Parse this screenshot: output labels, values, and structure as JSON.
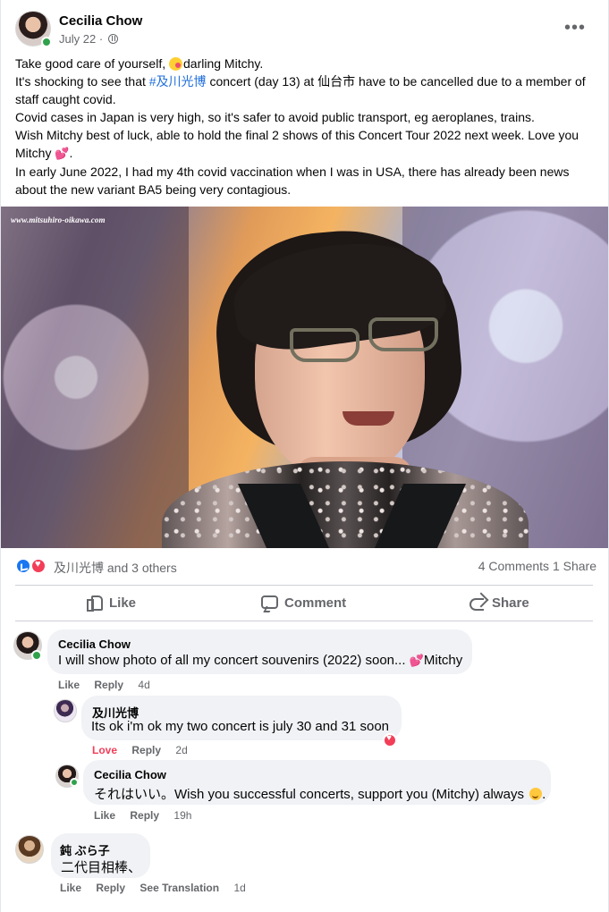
{
  "post": {
    "author": "Cecilia Chow",
    "date": "July 22",
    "date_separator": "·",
    "paragraphs": [
      {
        "before_emoji": "Take good care of yourself, ",
        "after_emoji": "darling Mitchy."
      },
      {
        "before_hashtag": "It's shocking to see that ",
        "hashtag": "#及川光博",
        "after_hashtag": " concert (day 13) at 仙台市 have to be cancelled due to a member of staff caught covid."
      },
      {
        "text": "Covid cases in Japan is very high, so it's safer to avoid public transport, eg aeroplanes, trains."
      },
      {
        "before_heart": "Wish Mitchy best of luck, able to hold the final 2 shows of this Concert Tour 2022 next week.  Love you Mitchy ",
        "heart": "💕",
        "after_heart": "."
      },
      {
        "text": "In early June 2022, I had my 4th covid vaccination when I was in USA, there has already been news about the new variant BA5 being very contagious."
      }
    ],
    "watermark": "www.mitsuhiro-oikawa.com",
    "reactions": {
      "names": "及川光博 and 3 others",
      "comments": "4 Comments",
      "shares": "1 Share"
    },
    "actions": {
      "like": "Like",
      "comment": "Comment",
      "share": "Share"
    }
  },
  "comments": [
    {
      "author": "Cecilia Chow",
      "text_before_heart": "I will show photo of all my concert souvenirs (2022) soon... ",
      "heart": "💕",
      "text_after_heart": "Mitchy",
      "actions": {
        "like": "Like",
        "reply": "Reply",
        "time": "4d"
      }
    },
    {
      "author": "及川光博",
      "text": "Its ok i'm ok my two concert is july 30 and 31 soon",
      "actions": {
        "reaction": "Love",
        "reply": "Reply",
        "time": "2d"
      }
    },
    {
      "author": "Cecilia Chow",
      "text": "それはいい。Wish you successful concerts, support you (Mitchy) always ",
      "end": ".",
      "actions": {
        "like": "Like",
        "reply": "Reply",
        "time": "19h"
      }
    },
    {
      "author": "鈍 ぶら子",
      "text": "二代目相棒、",
      "actions": {
        "like": "Like",
        "reply": "Reply",
        "translate": "See Translation",
        "time": "1d"
      }
    }
  ],
  "colors": {
    "accent": "#1877f2",
    "love": "#f33e58",
    "text_secondary": "#65676b",
    "bubble": "#f0f2f5"
  },
  "icons": [
    "more-options-icon",
    "globe-icon",
    "like-reaction-icon",
    "love-reaction-icon",
    "thumb-up-icon",
    "comment-icon",
    "share-icon"
  ]
}
